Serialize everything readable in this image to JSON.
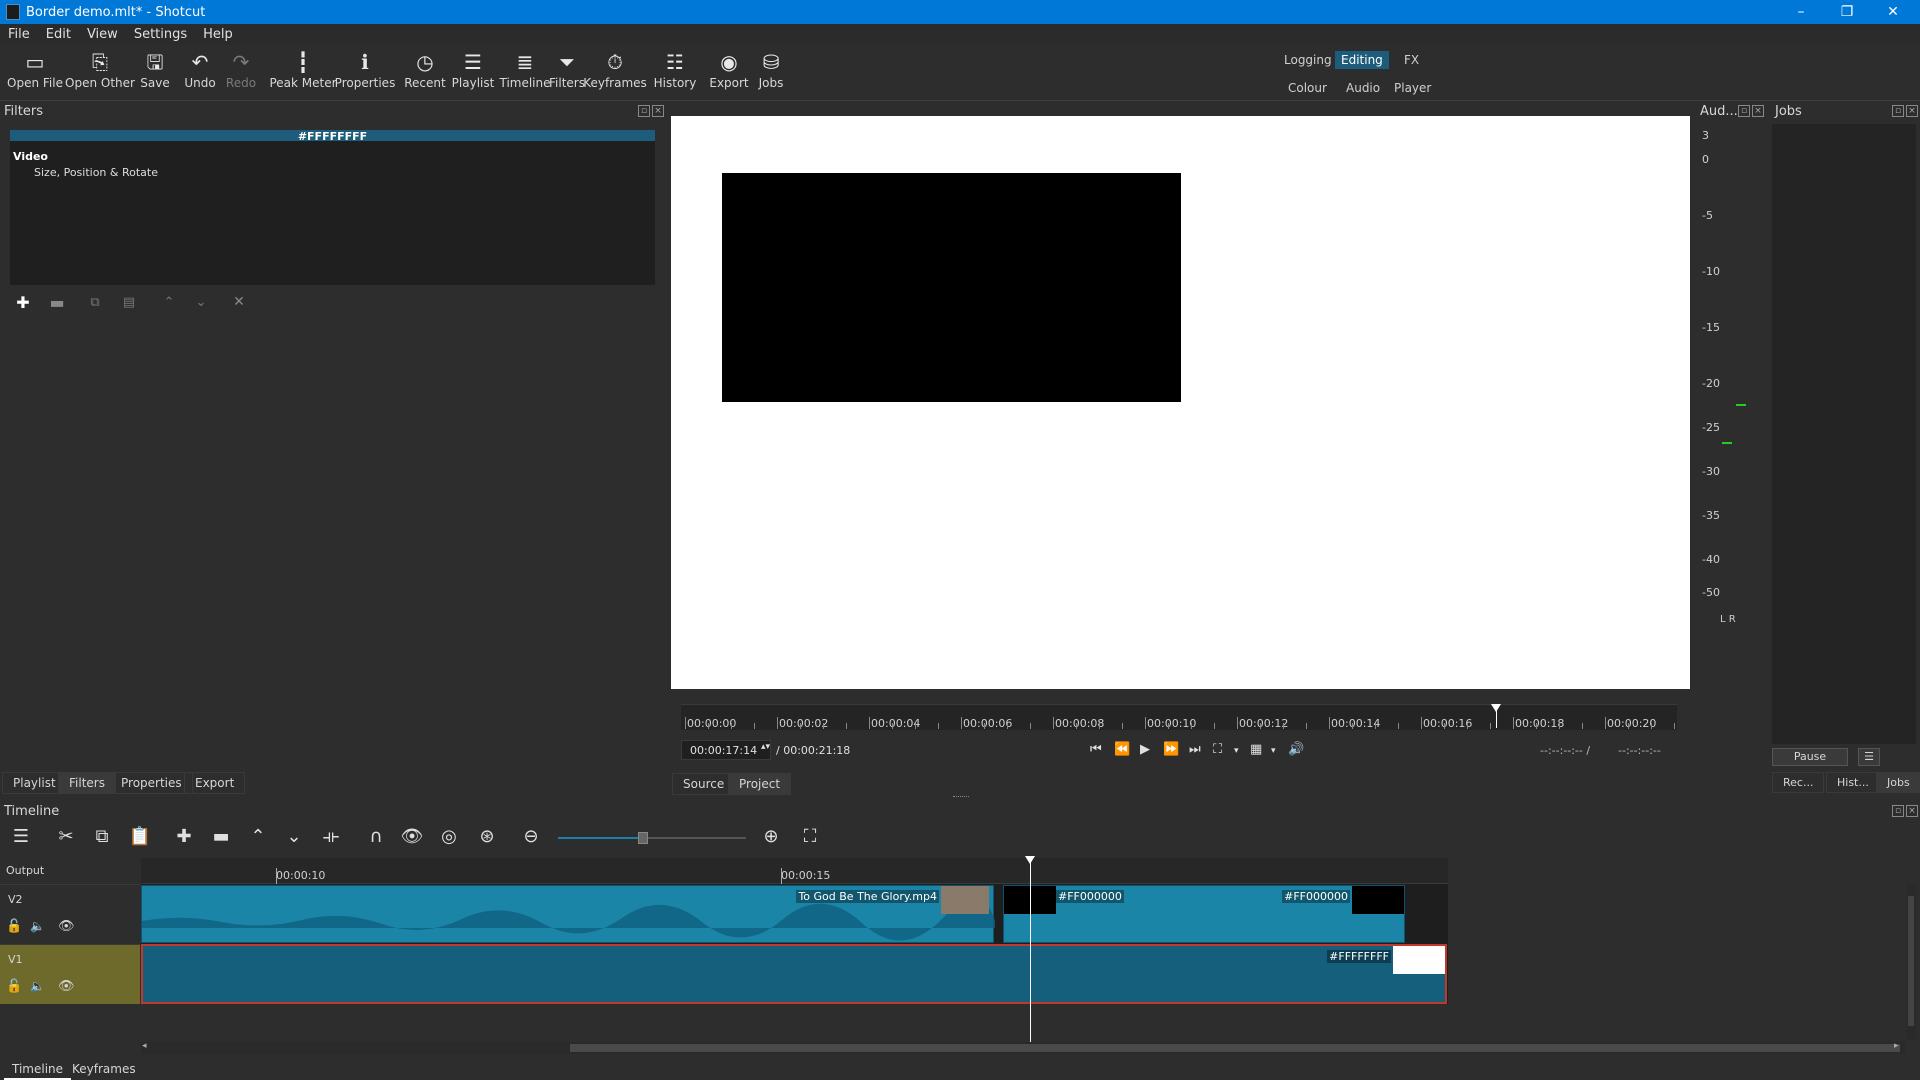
{
  "window": {
    "title": "Border demo.mlt* - Shotcut",
    "minimize": "–",
    "restore": "❐",
    "close": "✕"
  },
  "menu": [
    "File",
    "Edit",
    "View",
    "Settings",
    "Help"
  ],
  "toolbar": [
    {
      "label": "Open File",
      "icon": "open-file-icon",
      "glyph": "▭",
      "enabled": true
    },
    {
      "label": "Open Other",
      "icon": "open-other-icon",
      "glyph": "⎘",
      "enabled": true
    },
    {
      "label": "Save",
      "icon": "save-icon",
      "glyph": "🖫",
      "enabled": true
    },
    {
      "label": "Undo",
      "icon": "undo-icon",
      "glyph": "↶",
      "enabled": true
    },
    {
      "label": "Redo",
      "icon": "redo-icon",
      "glyph": "↷",
      "enabled": false
    },
    {
      "label": "Peak Meter",
      "icon": "peak-meter-icon",
      "glyph": "┇",
      "enabled": true
    },
    {
      "label": "Properties",
      "icon": "properties-icon",
      "glyph": "ℹ",
      "enabled": true
    },
    {
      "label": "Recent",
      "icon": "recent-icon",
      "glyph": "◷",
      "enabled": true
    },
    {
      "label": "Playlist",
      "icon": "playlist-icon",
      "glyph": "☰",
      "enabled": true
    },
    {
      "label": "Timeline",
      "icon": "timeline-icon",
      "glyph": "≣",
      "enabled": true
    },
    {
      "label": "Filters",
      "icon": "filters-icon",
      "glyph": "⏷",
      "enabled": true
    },
    {
      "label": "Keyframes",
      "icon": "keyframes-icon",
      "glyph": "⏱",
      "enabled": true
    },
    {
      "label": "History",
      "icon": "history-icon",
      "glyph": "☷",
      "enabled": true
    },
    {
      "label": "Export",
      "icon": "export-icon",
      "glyph": "◉",
      "enabled": true
    },
    {
      "label": "Jobs",
      "icon": "jobs-icon",
      "glyph": "⛁",
      "enabled": true
    }
  ],
  "layouts": {
    "logging": "Logging",
    "editing": "Editing",
    "fx": "FX",
    "colour": "Colour",
    "audio": "Audio",
    "player": "Player"
  },
  "filters_panel": {
    "title": "Filters",
    "current_clip": "#FFFFFFFF",
    "group": "Video",
    "items": [
      "Size, Position & Rotate"
    ]
  },
  "left_tabs": [
    "Playlist",
    "Filters",
    "Properties",
    "Export"
  ],
  "player": {
    "ruler_labels": [
      "00:00:00",
      "00:00:02",
      "00:00:04",
      "00:00:06",
      "00:00:08",
      "00:00:10",
      "00:00:12",
      "00:00:14",
      "00:00:16",
      "00:00:18",
      "00:00:20"
    ],
    "position": "00:00:17:14",
    "duration": "/ 00:00:21:18",
    "in_point": "--:--:--:-- /",
    "out_point": "--:--:--:--",
    "tabs": [
      "Source",
      "Project"
    ],
    "playhead_fraction": 0.818
  },
  "audio_meter": {
    "title": "Aud...",
    "scale": [
      "3",
      "0",
      "-5",
      "-10",
      "-15",
      "-20",
      "-25",
      "-30",
      "-35",
      "-40",
      "-50"
    ],
    "channels": "L  R",
    "accent": "#22cc22"
  },
  "jobs_panel": {
    "title": "Jobs",
    "pause": "Pause",
    "menu": "☰"
  },
  "right_tabs": [
    "Rec...",
    "Hist...",
    "Jobs"
  ],
  "timeline": {
    "title": "Timeline",
    "output": "Output",
    "ruler_labels": [
      "00:00:10",
      "00:00:15"
    ],
    "tracks": [
      {
        "name": "V2",
        "clips": [
          {
            "label": "To God Be The Glory.mp4"
          },
          {
            "label": "#FF000000"
          },
          {
            "label": "#FF000000"
          }
        ]
      },
      {
        "name": "V1",
        "clips": [
          {
            "label": "#FFFFFFFF"
          }
        ]
      }
    ],
    "zoom_level": 0.45
  },
  "bottom_tabs": [
    "Timeline",
    "Keyframes"
  ],
  "colors": {
    "accent": "#1d5c7a",
    "titlebar": "#0078d7",
    "clip": "#1b85a8",
    "selected_track": "#6e6a2b"
  }
}
